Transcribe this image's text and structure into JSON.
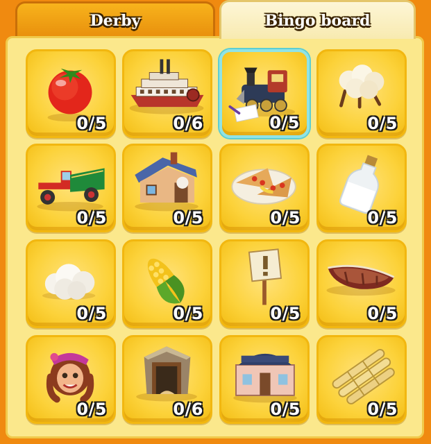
{
  "tabs": {
    "derby": "Derby",
    "bingo": "Bingo board"
  },
  "board": {
    "items": [
      {
        "icon": "tomato-icon",
        "progress": "0/5"
      },
      {
        "icon": "riverboat-icon",
        "progress": "0/6"
      },
      {
        "icon": "train-icon",
        "progress": "0/5",
        "selected": true
      },
      {
        "icon": "cotton-icon",
        "progress": "0/5"
      },
      {
        "icon": "truck-icon",
        "progress": "0/5"
      },
      {
        "icon": "house-icon",
        "progress": "0/5"
      },
      {
        "icon": "quesadilla-icon",
        "progress": "0/5"
      },
      {
        "icon": "milk-bottle-icon",
        "progress": "0/5"
      },
      {
        "icon": "wool-icon",
        "progress": "0/5"
      },
      {
        "icon": "corn-icon",
        "progress": "0/5"
      },
      {
        "icon": "sign-icon",
        "progress": "0/5"
      },
      {
        "icon": "rowboat-icon",
        "progress": "0/5"
      },
      {
        "icon": "woman-avatar-icon",
        "progress": "0/5"
      },
      {
        "icon": "mine-icon",
        "progress": "0/6"
      },
      {
        "icon": "shop-icon",
        "progress": "0/5"
      },
      {
        "icon": "sugarcane-icon",
        "progress": "0/5"
      }
    ]
  }
}
